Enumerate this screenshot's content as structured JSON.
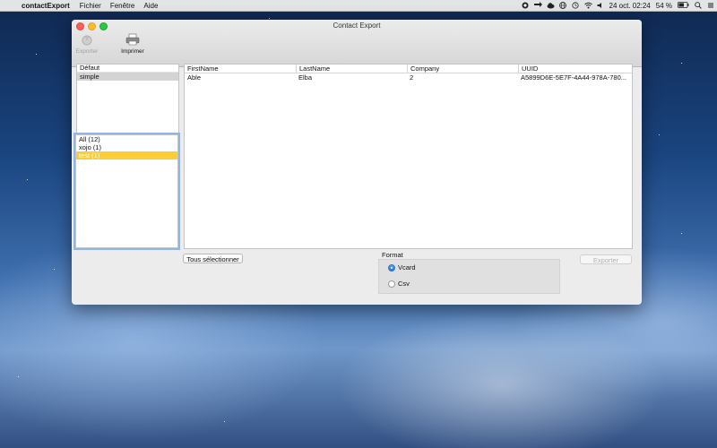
{
  "menubar": {
    "apple_glyph": "",
    "app_name": "contactExport",
    "menus": [
      "Fichier",
      "Fenêtre",
      "Aide"
    ],
    "date_time": "24 oct.  02:24",
    "battery": "54 %",
    "icons": [
      "circle-icon",
      "arrows-icon",
      "cloud-icon",
      "globe-icon",
      "time-machine-icon",
      "wifi-icon",
      "volume-icon",
      "battery-icon",
      "search-icon",
      "list-icon"
    ]
  },
  "window": {
    "title": "Contact Export",
    "toolbar": {
      "export_label": "Exporter",
      "print_label": "Imprimer"
    }
  },
  "groups_top": {
    "header": "Défaut",
    "items": [
      "simple"
    ]
  },
  "groups_bottom": {
    "items": [
      "All (12)",
      "xojo (1)",
      "test (1)"
    ]
  },
  "contacts": {
    "columns": [
      "FirstName",
      "LastName",
      "Company",
      "UUID"
    ],
    "rows": [
      [
        "Able",
        "Elba",
        "2",
        "A5899D6E-5E7F-4A44-978A-780..."
      ]
    ]
  },
  "buttons": {
    "select_all": "Tous sélectionner",
    "export": "Exporter"
  },
  "format": {
    "label": "Format",
    "options": [
      "Vcard",
      "Csv"
    ],
    "selected": "Vcard"
  },
  "colors": {
    "selection_yellow": "#fbcd37",
    "focus_ring": "#8fb6e5",
    "radio_blue": "#1c78e4"
  }
}
